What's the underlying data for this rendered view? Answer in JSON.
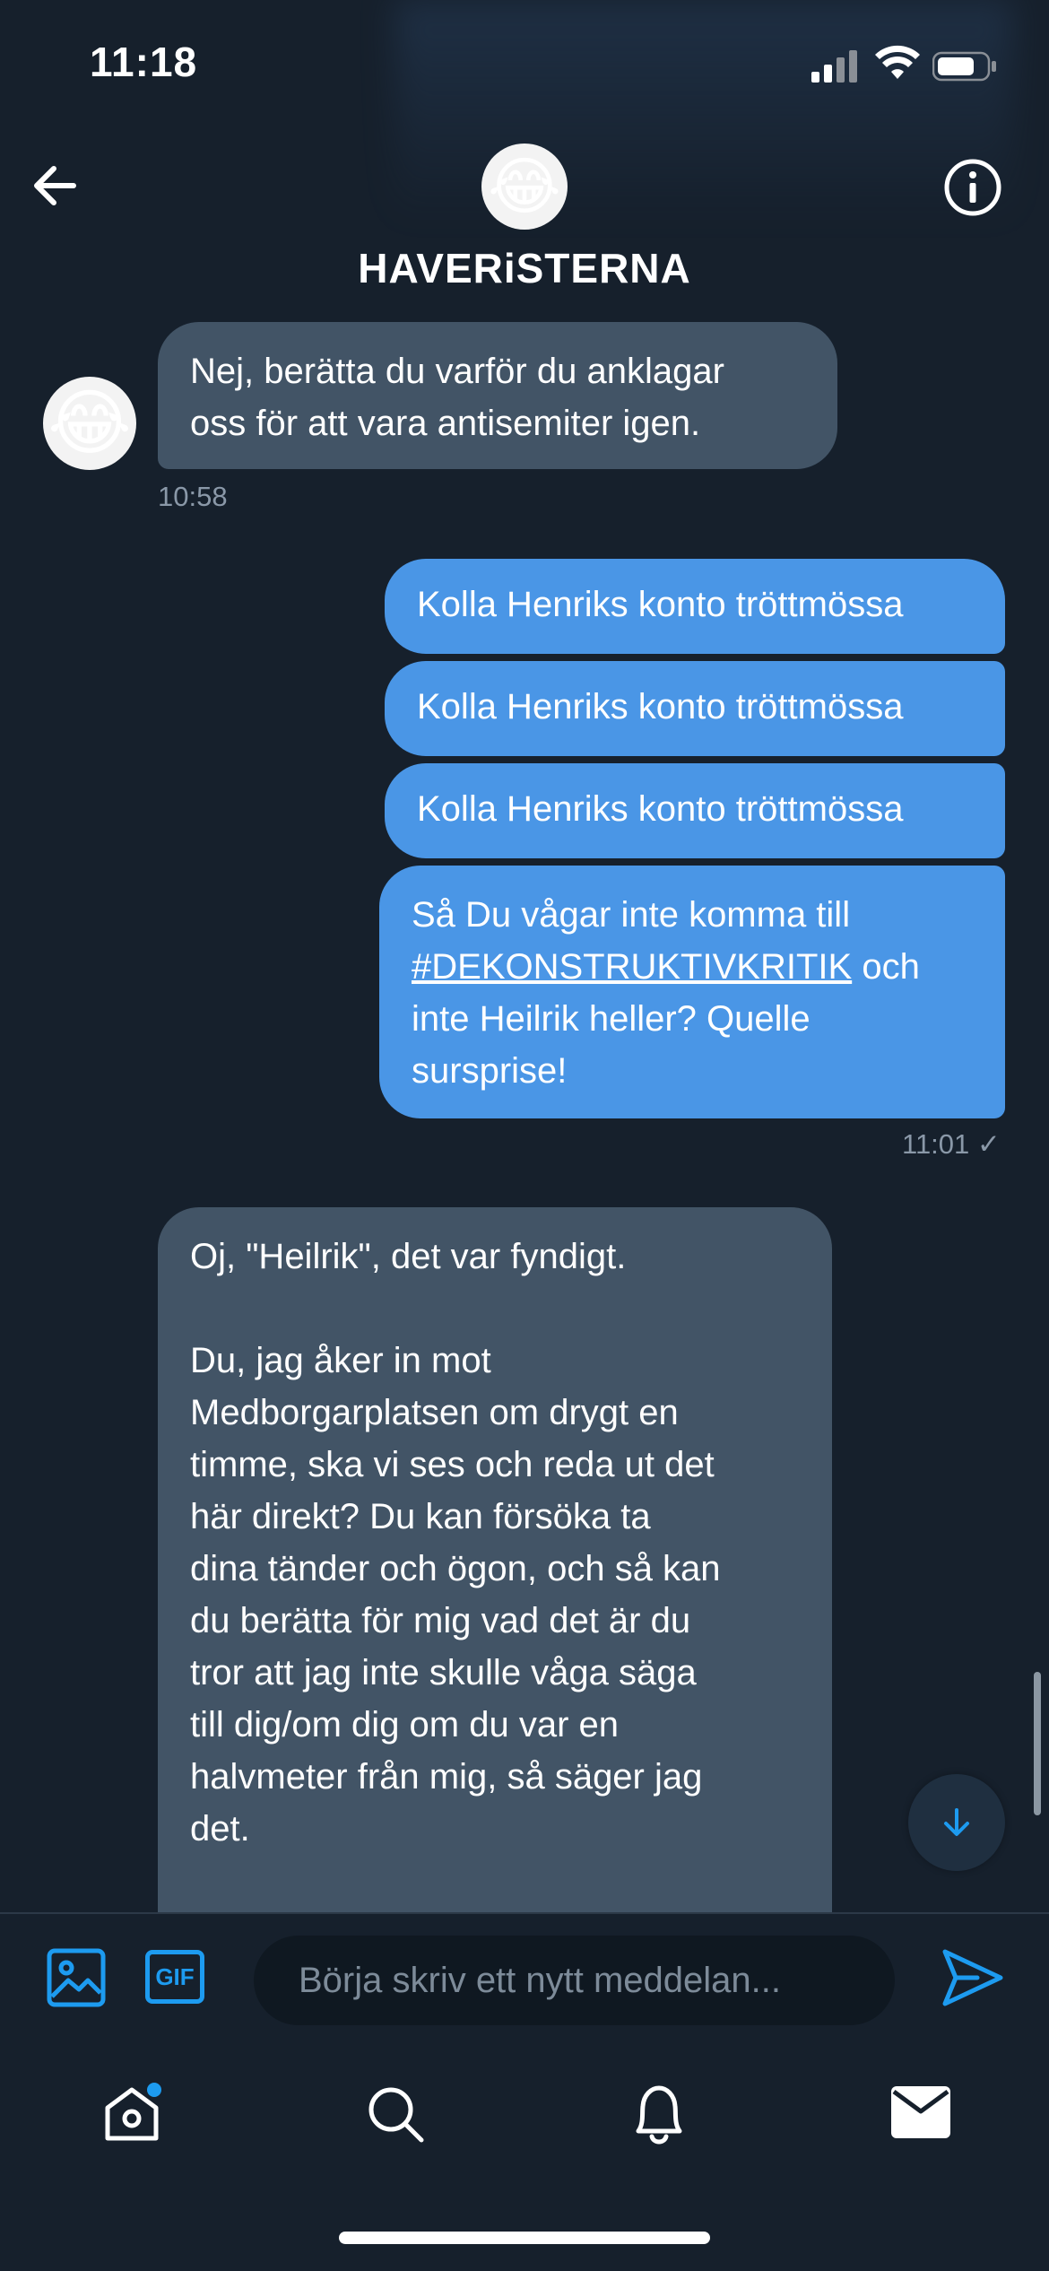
{
  "status_bar": {
    "time": "11:18"
  },
  "header": {
    "group_name": "HAVERiSTERNA",
    "avatar_emoji": "😂"
  },
  "messages": [
    {
      "side": "in",
      "text": "Nej, berätta du varför du anklagar\noss för att vara antisemiter igen.",
      "time": "10:58",
      "avatar_emoji": "😂"
    },
    {
      "side": "out",
      "text": "Kolla Henriks konto tröttmössa"
    },
    {
      "side": "out",
      "text": "Kolla Henriks konto tröttmössa"
    },
    {
      "side": "out",
      "text": "Kolla Henriks konto tröttmössa"
    },
    {
      "side": "out",
      "text_before": "Så Du vågar inte komma till\n",
      "hashtag": "#DEKONSTRUKTIVKRITIK",
      "text_after": " och\ninte Heilrik heller? Quelle\nsursprise!",
      "time": "11:01 ✓"
    },
    {
      "side": "in",
      "text": "Oj, \"Heilrik\", det var fyndigt.\n\nDu, jag åker in mot\nMedborgarplatsen om drygt en\ntimme, ska vi ses och reda ut det\nhär direkt? Du kan försöka ta\ndina tänder och ögon, och så kan\ndu berätta för mig vad det är du\ntror att jag inte skulle våga säga\ntill dig/om dig om du var en\nhalvmeter från mig, så säger jag\ndet."
    }
  ],
  "composer": {
    "placeholder": "Börja skriv ett nytt meddelan...",
    "gif_label": "GIF"
  },
  "colors": {
    "background": "#16202c",
    "incoming_bubble": "#425466",
    "outgoing_bubble": "#4a96e6",
    "accent": "#1d9bf0"
  },
  "icons": [
    "back-arrow-icon",
    "info-icon",
    "image-icon",
    "gif-icon",
    "send-icon",
    "home-icon",
    "search-icon",
    "bell-icon",
    "mail-icon",
    "scroll-down-icon"
  ]
}
